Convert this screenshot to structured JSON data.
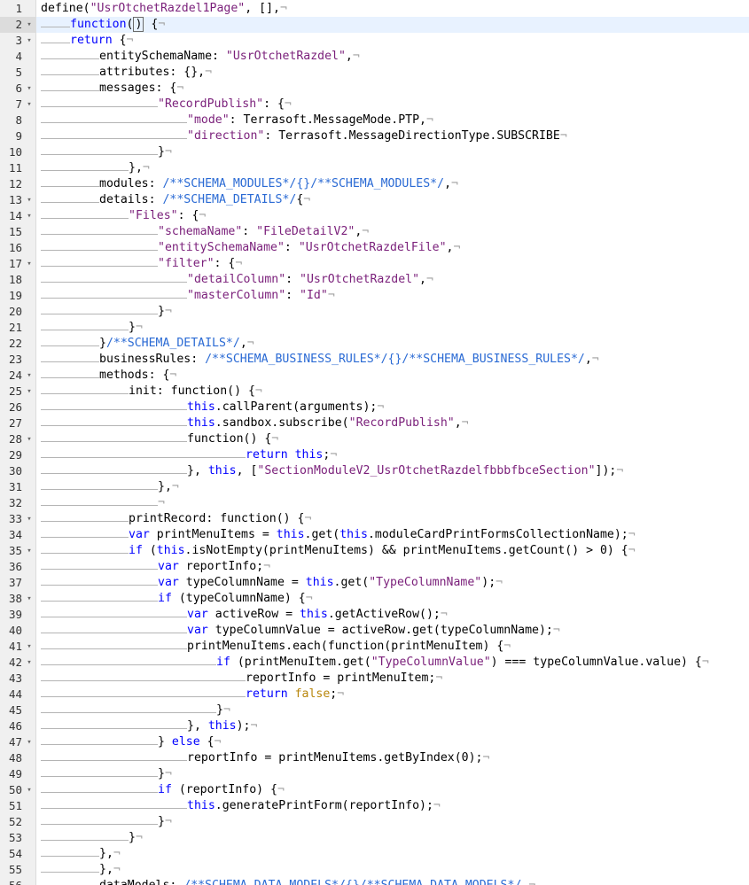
{
  "editor": {
    "lines": [
      {
        "n": "1",
        "fold": "",
        "indent": 0,
        "text": "define(\"UsrOtchetRazdel1Page\", [],",
        "tokens": [
          {
            "t": "define("
          },
          {
            "t": "\"UsrOtchetRazdel1Page\"",
            "c": "s"
          },
          {
            "t": ", [],"
          }
        ]
      },
      {
        "n": "2",
        "fold": "▾",
        "indent": 1,
        "active": true,
        "tokens": [
          {
            "t": "function",
            "c": "k"
          },
          {
            "t": "("
          },
          {
            "t": ")",
            "cur": true
          },
          {
            "t": " {"
          }
        ]
      },
      {
        "n": "3",
        "fold": "▾",
        "indent": 1,
        "tokens": [
          {
            "t": "return",
            "c": "k"
          },
          {
            "t": " {"
          }
        ]
      },
      {
        "n": "4",
        "fold": "",
        "indent": 2,
        "tokens": [
          {
            "t": "entitySchemaName: "
          },
          {
            "t": "\"UsrOtchetRazdel\"",
            "c": "s"
          },
          {
            "t": ","
          }
        ]
      },
      {
        "n": "5",
        "fold": "",
        "indent": 2,
        "tokens": [
          {
            "t": "attributes: {},"
          }
        ]
      },
      {
        "n": "6",
        "fold": "▾",
        "indent": 2,
        "tokens": [
          {
            "t": "messages: {"
          }
        ]
      },
      {
        "n": "7",
        "fold": "▾",
        "indent": 4,
        "tokens": [
          {
            "t": "\"RecordPublish\"",
            "c": "s"
          },
          {
            "t": ": {"
          }
        ]
      },
      {
        "n": "8",
        "fold": "",
        "indent": 5,
        "tokens": [
          {
            "t": "\"mode\"",
            "c": "s"
          },
          {
            "t": ": Terrasoft.MessageMode.PTP,"
          }
        ]
      },
      {
        "n": "9",
        "fold": "",
        "indent": 5,
        "tokens": [
          {
            "t": "\"direction\"",
            "c": "s"
          },
          {
            "t": ": Terrasoft.MessageDirectionType.SUBSCRIBE"
          }
        ]
      },
      {
        "n": "10",
        "fold": "",
        "indent": 4,
        "tokens": [
          {
            "t": "}"
          }
        ]
      },
      {
        "n": "11",
        "fold": "",
        "indent": 3,
        "tokens": [
          {
            "t": "},"
          }
        ]
      },
      {
        "n": "12",
        "fold": "",
        "indent": 2,
        "tokens": [
          {
            "t": "modules: "
          },
          {
            "t": "/**SCHEMA_MODULES*/{}/**SCHEMA_MODULES*/",
            "c": "c"
          },
          {
            "t": ","
          }
        ]
      },
      {
        "n": "13",
        "fold": "▾",
        "indent": 2,
        "tokens": [
          {
            "t": "details: "
          },
          {
            "t": "/**SCHEMA_DETAILS*/",
            "c": "c"
          },
          {
            "t": "{"
          }
        ]
      },
      {
        "n": "14",
        "fold": "▾",
        "indent": 3,
        "tokens": [
          {
            "t": "\"Files\"",
            "c": "s"
          },
          {
            "t": ": {"
          }
        ]
      },
      {
        "n": "15",
        "fold": "",
        "indent": 4,
        "tokens": [
          {
            "t": "\"schemaName\"",
            "c": "s"
          },
          {
            "t": ": "
          },
          {
            "t": "\"FileDetailV2\"",
            "c": "s"
          },
          {
            "t": ","
          }
        ]
      },
      {
        "n": "16",
        "fold": "",
        "indent": 4,
        "tokens": [
          {
            "t": "\"entitySchemaName\"",
            "c": "s"
          },
          {
            "t": ": "
          },
          {
            "t": "\"UsrOtchetRazdelFile\"",
            "c": "s"
          },
          {
            "t": ","
          }
        ]
      },
      {
        "n": "17",
        "fold": "▾",
        "indent": 4,
        "tokens": [
          {
            "t": "\"filter\"",
            "c": "s"
          },
          {
            "t": ": {"
          }
        ]
      },
      {
        "n": "18",
        "fold": "",
        "indent": 5,
        "tokens": [
          {
            "t": "\"detailColumn\"",
            "c": "s"
          },
          {
            "t": ": "
          },
          {
            "t": "\"UsrOtchetRazdel\"",
            "c": "s"
          },
          {
            "t": ","
          }
        ]
      },
      {
        "n": "19",
        "fold": "",
        "indent": 5,
        "tokens": [
          {
            "t": "\"masterColumn\"",
            "c": "s"
          },
          {
            "t": ": "
          },
          {
            "t": "\"Id\"",
            "c": "s"
          }
        ]
      },
      {
        "n": "20",
        "fold": "",
        "indent": 4,
        "tokens": [
          {
            "t": "}"
          }
        ]
      },
      {
        "n": "21",
        "fold": "",
        "indent": 3,
        "tokens": [
          {
            "t": "}"
          }
        ]
      },
      {
        "n": "22",
        "fold": "",
        "indent": 2,
        "tokens": [
          {
            "t": "}"
          },
          {
            "t": "/**SCHEMA_DETAILS*/",
            "c": "c"
          },
          {
            "t": ","
          }
        ]
      },
      {
        "n": "23",
        "fold": "",
        "indent": 2,
        "tokens": [
          {
            "t": "businessRules: "
          },
          {
            "t": "/**SCHEMA_BUSINESS_RULES*/{}/**SCHEMA_BUSINESS_RULES*/",
            "c": "c"
          },
          {
            "t": ","
          }
        ]
      },
      {
        "n": "24",
        "fold": "▾",
        "indent": 2,
        "tokens": [
          {
            "t": "methods: {"
          }
        ]
      },
      {
        "n": "25",
        "fold": "▾",
        "indent": 3,
        "tokens": [
          {
            "t": "init: function() {"
          }
        ]
      },
      {
        "n": "26",
        "fold": "",
        "indent": 5,
        "tokens": [
          {
            "t": "this",
            "c": "k"
          },
          {
            "t": ".callParent(arguments);"
          }
        ]
      },
      {
        "n": "27",
        "fold": "",
        "indent": 5,
        "tokens": [
          {
            "t": "this",
            "c": "k"
          },
          {
            "t": ".sandbox.subscribe("
          },
          {
            "t": "\"RecordPublish\"",
            "c": "s"
          },
          {
            "t": ","
          }
        ]
      },
      {
        "n": "28",
        "fold": "▾",
        "indent": 5,
        "tokens": [
          {
            "t": "function() {"
          }
        ]
      },
      {
        "n": "29",
        "fold": "",
        "indent": 7,
        "tokens": [
          {
            "t": "return",
            "c": "k"
          },
          {
            "t": " "
          },
          {
            "t": "this",
            "c": "k"
          },
          {
            "t": ";"
          }
        ]
      },
      {
        "n": "30",
        "fold": "",
        "indent": 5,
        "tokens": [
          {
            "t": "}, "
          },
          {
            "t": "this",
            "c": "k"
          },
          {
            "t": ", ["
          },
          {
            "t": "\"SectionModuleV2_UsrOtchetRazdelfbbbfbceSection\"",
            "c": "s"
          },
          {
            "t": "]);"
          }
        ]
      },
      {
        "n": "31",
        "fold": "",
        "indent": 4,
        "tokens": [
          {
            "t": "},"
          }
        ]
      },
      {
        "n": "32",
        "fold": "",
        "indent": 4,
        "tokens": []
      },
      {
        "n": "33",
        "fold": "▾",
        "indent": 3,
        "tokens": [
          {
            "t": "printRecord: function() {"
          }
        ]
      },
      {
        "n": "34",
        "fold": "",
        "indent": 3,
        "tokens": [
          {
            "t": "var",
            "c": "k"
          },
          {
            "t": " printMenuItems = "
          },
          {
            "t": "this",
            "c": "k"
          },
          {
            "t": ".get("
          },
          {
            "t": "this",
            "c": "k"
          },
          {
            "t": ".moduleCardPrintFormsCollectionName);"
          }
        ]
      },
      {
        "n": "35",
        "fold": "▾",
        "indent": 3,
        "tokens": [
          {
            "t": "if",
            "c": "k"
          },
          {
            "t": " ("
          },
          {
            "t": "this",
            "c": "k"
          },
          {
            "t": ".isNotEmpty(printMenuItems) && printMenuItems.getCount() > 0) {"
          }
        ]
      },
      {
        "n": "36",
        "fold": "",
        "indent": 4,
        "tokens": [
          {
            "t": "var",
            "c": "k"
          },
          {
            "t": " reportInfo;"
          }
        ]
      },
      {
        "n": "37",
        "fold": "",
        "indent": 4,
        "tokens": [
          {
            "t": "var",
            "c": "k"
          },
          {
            "t": " typeColumnName = "
          },
          {
            "t": "this",
            "c": "k"
          },
          {
            "t": ".get("
          },
          {
            "t": "\"TypeColumnName\"",
            "c": "s"
          },
          {
            "t": ");"
          }
        ]
      },
      {
        "n": "38",
        "fold": "▾",
        "indent": 4,
        "tokens": [
          {
            "t": "if",
            "c": "k"
          },
          {
            "t": " (typeColumnName) {"
          }
        ]
      },
      {
        "n": "39",
        "fold": "",
        "indent": 5,
        "tokens": [
          {
            "t": "var",
            "c": "k"
          },
          {
            "t": " activeRow = "
          },
          {
            "t": "this",
            "c": "k"
          },
          {
            "t": ".getActiveRow();"
          }
        ]
      },
      {
        "n": "40",
        "fold": "",
        "indent": 5,
        "tokens": [
          {
            "t": "var",
            "c": "k"
          },
          {
            "t": " typeColumnValue = activeRow.get(typeColumnName);"
          }
        ]
      },
      {
        "n": "41",
        "fold": "▾",
        "indent": 5,
        "tokens": [
          {
            "t": "printMenuItems.each(function(printMenuItem) {"
          }
        ]
      },
      {
        "n": "42",
        "fold": "▾",
        "indent": 6,
        "tokens": [
          {
            "t": "if",
            "c": "k"
          },
          {
            "t": " (printMenuItem.get("
          },
          {
            "t": "\"TypeColumnValue\"",
            "c": "s"
          },
          {
            "t": ") === typeColumnValue.value) {"
          }
        ]
      },
      {
        "n": "43",
        "fold": "",
        "indent": 7,
        "tokens": [
          {
            "t": "reportInfo = printMenuItem;"
          }
        ]
      },
      {
        "n": "44",
        "fold": "",
        "indent": 7,
        "tokens": [
          {
            "t": "return",
            "c": "k"
          },
          {
            "t": " "
          },
          {
            "t": "false",
            "c": "b"
          },
          {
            "t": ";"
          }
        ]
      },
      {
        "n": "45",
        "fold": "",
        "indent": 6,
        "tokens": [
          {
            "t": "}"
          }
        ]
      },
      {
        "n": "46",
        "fold": "",
        "indent": 5,
        "tokens": [
          {
            "t": "}, "
          },
          {
            "t": "this",
            "c": "k"
          },
          {
            "t": ");"
          }
        ]
      },
      {
        "n": "47",
        "fold": "▾",
        "indent": 4,
        "tokens": [
          {
            "t": "} "
          },
          {
            "t": "else",
            "c": "k"
          },
          {
            "t": " {"
          }
        ]
      },
      {
        "n": "48",
        "fold": "",
        "indent": 5,
        "tokens": [
          {
            "t": "reportInfo = printMenuItems.getByIndex(0);"
          }
        ]
      },
      {
        "n": "49",
        "fold": "",
        "indent": 4,
        "tokens": [
          {
            "t": "}"
          }
        ]
      },
      {
        "n": "50",
        "fold": "▾",
        "indent": 4,
        "tokens": [
          {
            "t": "if",
            "c": "k"
          },
          {
            "t": " (reportInfo) {"
          }
        ]
      },
      {
        "n": "51",
        "fold": "",
        "indent": 5,
        "tokens": [
          {
            "t": "this",
            "c": "k"
          },
          {
            "t": ".generatePrintForm(reportInfo);"
          }
        ]
      },
      {
        "n": "52",
        "fold": "",
        "indent": 4,
        "tokens": [
          {
            "t": "}"
          }
        ]
      },
      {
        "n": "53",
        "fold": "",
        "indent": 3,
        "tokens": [
          {
            "t": "}"
          }
        ]
      },
      {
        "n": "54",
        "fold": "",
        "indent": 2,
        "tokens": [
          {
            "t": "},"
          }
        ]
      },
      {
        "n": "55",
        "fold": "",
        "indent": 2,
        "tokens": [
          {
            "t": "},"
          }
        ]
      },
      {
        "n": "56",
        "fold": "",
        "indent": 2,
        "tokens": [
          {
            "t": "dataModels: "
          },
          {
            "t": "/**SCHEMA_DATA_MODELS*/{}/**SCHEMA_DATA_MODELS*/",
            "c": "c"
          },
          {
            "t": ","
          }
        ]
      }
    ]
  }
}
